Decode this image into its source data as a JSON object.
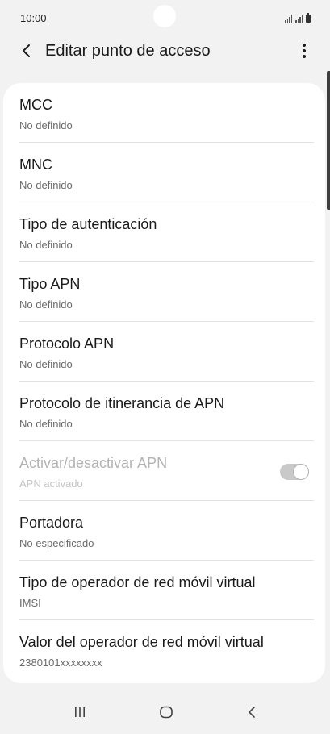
{
  "status_bar": {
    "time": "10:00",
    "icons": [
      "signal-icon",
      "signal-icon",
      "battery-icon"
    ]
  },
  "header": {
    "title": "Editar punto de acceso",
    "back_icon": "chevron-left-icon",
    "more_icon": "more-vertical-icon"
  },
  "settings": [
    {
      "title": "MCC",
      "value": "No definido"
    },
    {
      "title": "MNC",
      "value": "No definido"
    },
    {
      "title": "Tipo de autenticación",
      "value": "No definido"
    },
    {
      "title": "Tipo APN",
      "value": "No definido"
    },
    {
      "title": "Protocolo APN",
      "value": "No definido"
    },
    {
      "title": "Protocolo de itinerancia de APN",
      "value": "No definido"
    },
    {
      "title": "Activar/desactivar APN",
      "value": "APN activado",
      "disabled": true,
      "toggle_on": true
    },
    {
      "title": "Portadora",
      "value": "No especificado"
    },
    {
      "title": "Tipo de operador de red móvil virtual",
      "value": "IMSI"
    },
    {
      "title": "Valor del operador de red móvil virtual",
      "value": "2380101xxxxxxxx"
    }
  ],
  "nav_bar": {
    "items": [
      "recents-icon",
      "home-icon",
      "back-icon"
    ]
  },
  "colors": {
    "background": "#f2f2f2",
    "card": "#ffffff",
    "text_primary": "#1a1a1a",
    "text_secondary": "#6b6b6b",
    "text_disabled": "#b3b3b3"
  }
}
